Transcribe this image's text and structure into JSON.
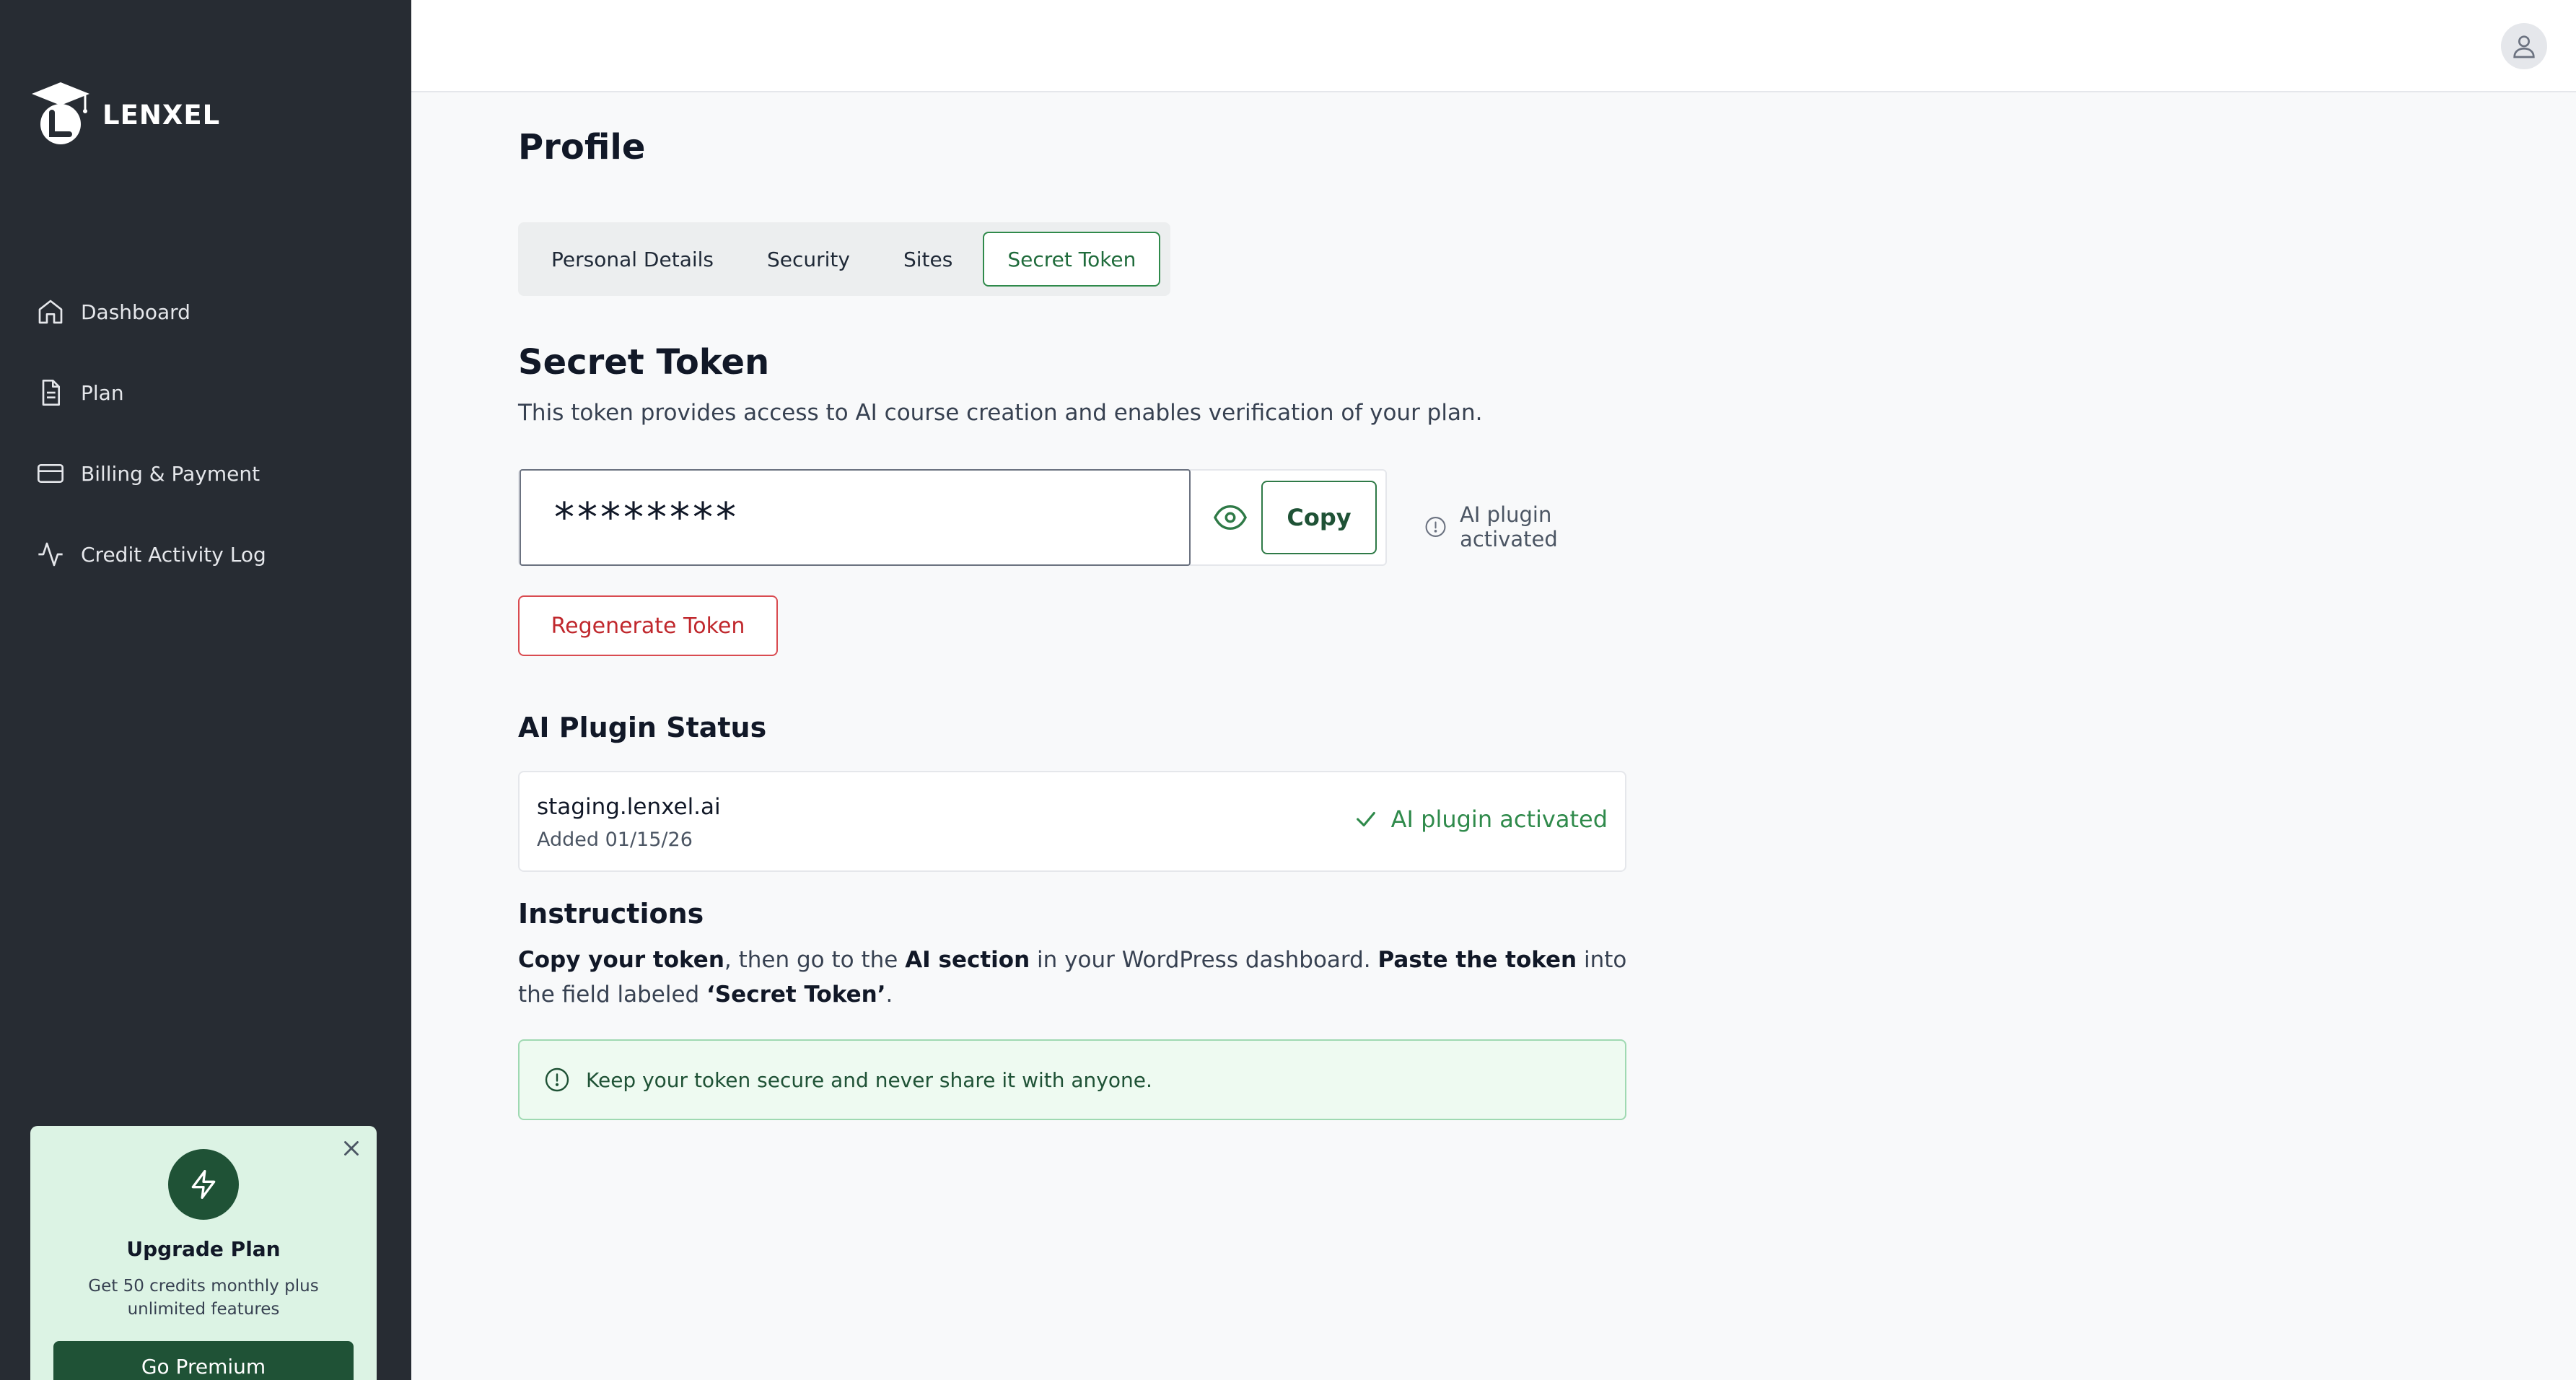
{
  "brand": {
    "name": "LENXEL"
  },
  "sidebar": {
    "items": [
      {
        "label": "Dashboard",
        "icon": "home-icon"
      },
      {
        "label": "Plan",
        "icon": "document-icon"
      },
      {
        "label": "Billing & Payment",
        "icon": "credit-card-icon"
      },
      {
        "label": "Credit Activity Log",
        "icon": "activity-icon"
      }
    ]
  },
  "upgrade": {
    "title": "Upgrade Plan",
    "description": "Get 50 credits monthly plus unlimited features",
    "button": "Go Premium",
    "icon": "lightning-icon"
  },
  "header": {
    "avatar_icon": "user-icon"
  },
  "page": {
    "title": "Profile"
  },
  "tabs": [
    {
      "label": "Personal Details",
      "active": false
    },
    {
      "label": "Security",
      "active": false
    },
    {
      "label": "Sites",
      "active": false
    },
    {
      "label": "Secret Token",
      "active": true
    }
  ],
  "token": {
    "title": "Secret Token",
    "description": "This token provides access to AI course creation and enables verification of your plan.",
    "value": "********",
    "copy_label": "Copy",
    "status_hint": "AI plugin activated",
    "regenerate_label": "Regenerate Token"
  },
  "plugin": {
    "title": "AI Plugin Status",
    "domain": "staging.lenxel.ai",
    "added": "Added 01/15/26",
    "status": "AI plugin activated"
  },
  "instructions": {
    "title": "Instructions",
    "parts": {
      "p1": "Copy your token",
      "p2": ", then go to the ",
      "p3": "AI section",
      "p4": " in your WordPress dashboard. ",
      "p5": "Paste the token",
      "p6": " into the field labeled ",
      "p7": "‘Secret Token’",
      "p8": "."
    }
  },
  "note": {
    "text": "Keep your token secure and never share it with anyone."
  },
  "colors": {
    "sidebar_bg": "#272c33",
    "accent_green": "#1f5236",
    "success_green": "#2f8a4b",
    "danger_red": "#c0282d",
    "note_bg": "#eefaf1"
  }
}
